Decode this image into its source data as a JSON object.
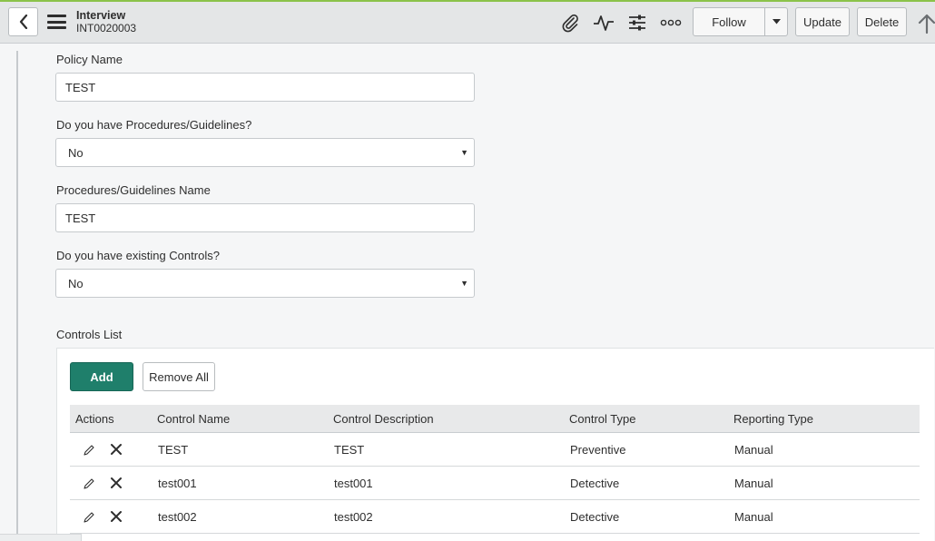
{
  "header": {
    "title": "Interview",
    "record_number": "INT0020003",
    "follow_label": "Follow",
    "update_label": "Update",
    "delete_label": "Delete",
    "icons": [
      "back-icon",
      "menu-icon",
      "paperclip-icon",
      "activity-icon",
      "settings-sliders-icon",
      "more-icon",
      "caret-down-icon",
      "arrow-up-icon"
    ]
  },
  "form": {
    "policy_name_label": "Policy Name",
    "policy_name_value": "TEST",
    "procedures_question_label": "Do you have Procedures/Guidelines?",
    "procedures_question_value": "No",
    "procedures_name_label": "Procedures/Guidelines Name",
    "procedures_name_value": "TEST",
    "controls_question_label": "Do you have existing Controls?",
    "controls_question_value": "No"
  },
  "controls": {
    "section_label": "Controls List",
    "add_label": "Add",
    "remove_all_label": "Remove All",
    "columns": [
      "Actions",
      "Control Name",
      "Control Description",
      "Control Type",
      "Reporting Type"
    ],
    "rows": [
      {
        "name": "TEST",
        "description": "TEST",
        "type": "Preventive",
        "reporting": "Manual"
      },
      {
        "name": "test001",
        "description": "test001",
        "type": "Detective",
        "reporting": "Manual"
      },
      {
        "name": "test002",
        "description": "test002",
        "type": "Detective",
        "reporting": "Manual"
      }
    ]
  },
  "colors": {
    "accent": "#8bc34a",
    "primary_button": "#1f7f6b",
    "header_bg": "#e4e6e7"
  }
}
